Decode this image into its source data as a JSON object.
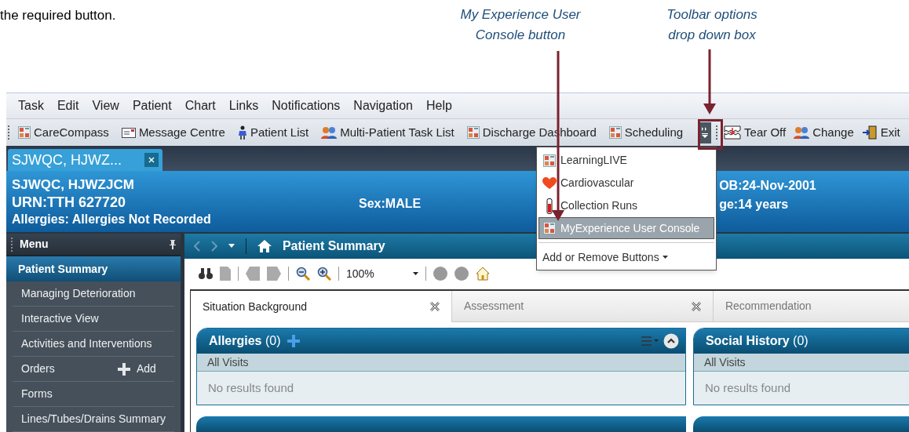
{
  "document": {
    "text": "the required button.",
    "callouts": [
      {
        "text": "My Experience User Console button"
      },
      {
        "text": "Toolbar options drop down box"
      }
    ]
  },
  "menu_bar": [
    "Task",
    "Edit",
    "View",
    "Patient",
    "Chart",
    "Links",
    "Notifications",
    "Navigation",
    "Help"
  ],
  "toolbar": {
    "items": [
      {
        "label": "CareCompass",
        "kind": "grid"
      },
      {
        "label": "Message Centre",
        "kind": "mail"
      },
      {
        "label": "Patient List",
        "kind": "person"
      },
      {
        "label": "Multi-Patient Task List",
        "kind": "people"
      },
      {
        "label": "Discharge Dashboard",
        "kind": "grid"
      },
      {
        "label": "Scheduling",
        "kind": "grid"
      }
    ],
    "trailing": [
      {
        "label": "Tear Off",
        "kind": "tear"
      },
      {
        "label": "Change",
        "kind": "people"
      },
      {
        "label": "Exit",
        "kind": "exit"
      }
    ]
  },
  "patient_tab": {
    "label": "SJWQC, HJWZ..."
  },
  "banner": {
    "name": "SJWQC, HJWZJCM",
    "urn": "URN:TTH 627720",
    "allergies": "Allergies: Allergies Not Recorded",
    "sex": "Sex:MALE",
    "dob": "OB:24-Nov-2001",
    "age": "ge:14 years"
  },
  "dropdown": {
    "items": [
      {
        "label": "LearningLIVE",
        "kind": "grid",
        "selected": false
      },
      {
        "label": "Cardiovascular",
        "kind": "heart",
        "selected": false
      },
      {
        "label": "Collection Runs",
        "kind": "tube",
        "selected": false
      },
      {
        "label": "MyExperience User Console",
        "kind": "grid",
        "selected": true
      }
    ],
    "footer": "Add or Remove Buttons"
  },
  "sidebar": {
    "title": "Menu",
    "items": [
      {
        "label": "Patient Summary",
        "selected": true
      },
      {
        "label": "Managing Deterioration",
        "selected": false
      },
      {
        "label": "Interactive View",
        "selected": false
      },
      {
        "label": "Activities and Interventions",
        "selected": false
      },
      {
        "label": "Orders",
        "selected": false,
        "action": "Add"
      },
      {
        "label": "Forms",
        "selected": false
      },
      {
        "label": "Lines/Tubes/Drains Summary",
        "selected": false
      }
    ]
  },
  "content": {
    "title": "Patient Summary",
    "zoom": "100%",
    "tabs": [
      {
        "label": "Situation Background",
        "selected": true
      },
      {
        "label": "Assessment",
        "selected": false
      },
      {
        "label": "Recommendation",
        "selected": false
      }
    ],
    "panels": [
      {
        "title": "Allergies",
        "count": "(0)",
        "filter": "All Visits",
        "empty": "No results found",
        "addable": true
      },
      {
        "title": "Social History",
        "count": "(0)",
        "filter": "All Visits",
        "empty": "No results found",
        "addable": false
      }
    ]
  }
}
